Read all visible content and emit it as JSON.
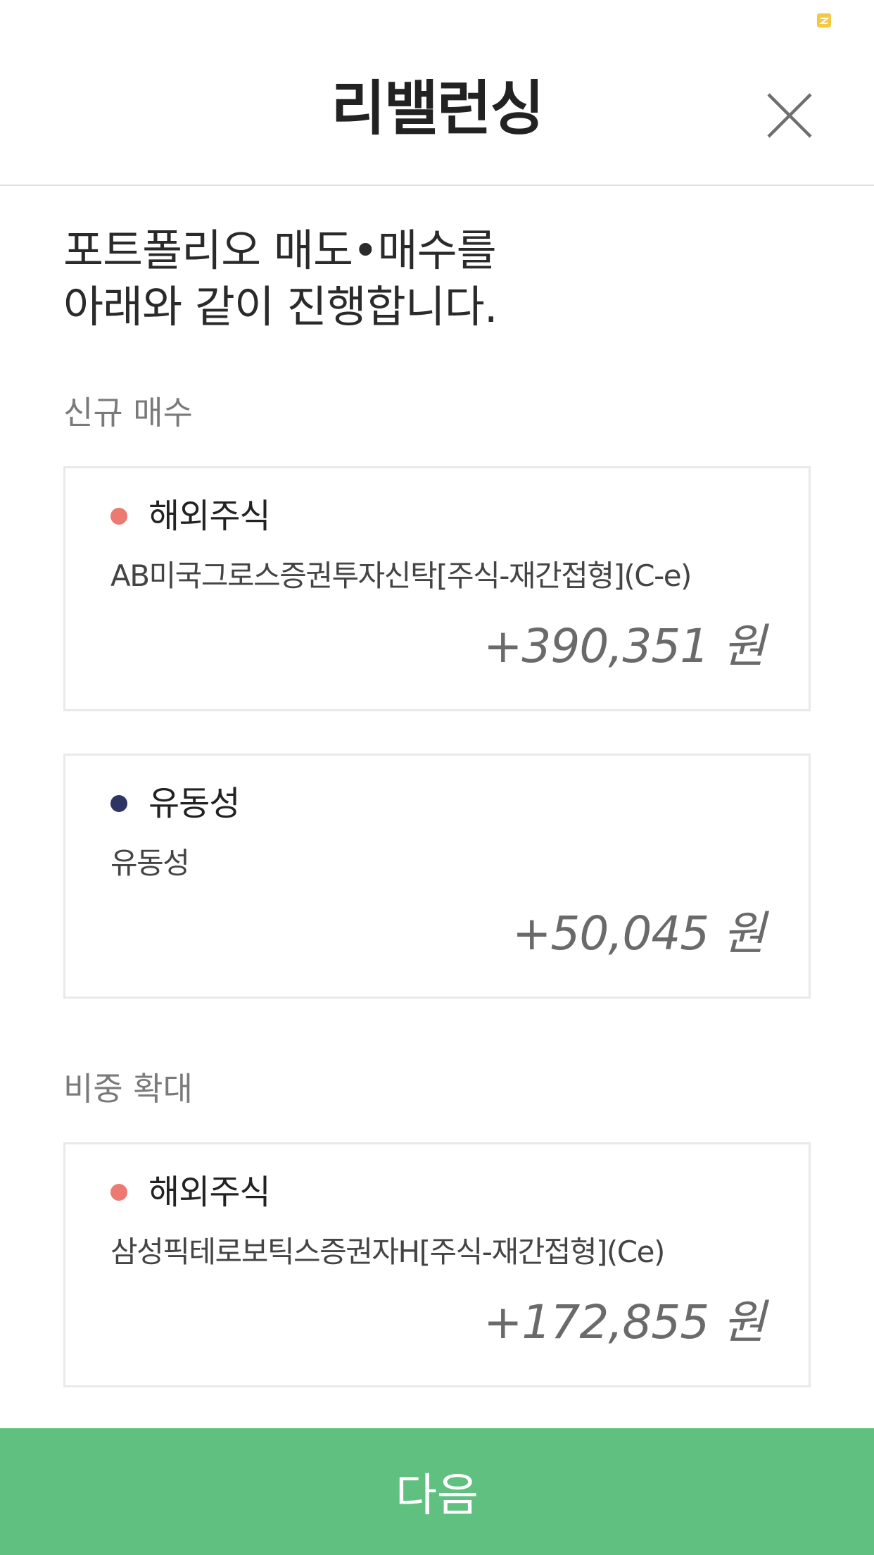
{
  "header": {
    "title": "리밸런싱",
    "close_icon": "close-icon"
  },
  "intro": {
    "line1": "포트폴리오 매도•매수를",
    "line2": "아래와 같이 진행합니다."
  },
  "sections": [
    {
      "label": "신규 매수",
      "items": [
        {
          "category": "해외주식",
          "dot_color": "#ec7a72",
          "name": "AB미국그로스증권투자신탁[주식-재간접형](C-e)",
          "amount": "+390,351 원"
        },
        {
          "category": "유동성",
          "dot_color": "#2f3563",
          "name": "유동성",
          "amount": "+50,045 원"
        }
      ]
    },
    {
      "label": "비중 확대",
      "items": [
        {
          "category": "해외주식",
          "dot_color": "#ec7a72",
          "name": "삼성픽테로보틱스증권자H[주식-재간접형](Ce)",
          "amount": "+172,855 원"
        }
      ]
    }
  ],
  "footer": {
    "next_label": "다음"
  },
  "colors": {
    "accent_green": "#5fc080",
    "status_mark": "#f5c842"
  }
}
